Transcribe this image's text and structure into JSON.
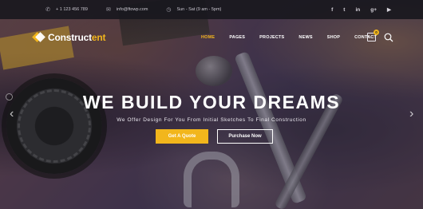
{
  "topbar": {
    "phone": "+ 1 123 456 789",
    "email": "info@ftowp.com",
    "hours": "Sun - Sat (9 am - 5pm)",
    "icons": {
      "phone": "phone-icon",
      "email": "envelope-icon",
      "hours": "clock-icon"
    },
    "socials": [
      {
        "name": "facebook-icon",
        "glyph": "f"
      },
      {
        "name": "twitter-icon",
        "glyph": "t"
      },
      {
        "name": "linkedin-icon",
        "glyph": "in"
      },
      {
        "name": "google-plus-icon",
        "glyph": "g+"
      },
      {
        "name": "youtube-icon",
        "glyph": "▶"
      }
    ]
  },
  "brand": {
    "name_main": "Construct",
    "name_accent": "ent",
    "accent_color": "#f2b61c"
  },
  "nav": {
    "items": [
      {
        "label": "HOME",
        "active": true
      },
      {
        "label": "PAGES",
        "active": false
      },
      {
        "label": "PROJECTS",
        "active": false
      },
      {
        "label": "NEWS",
        "active": false
      },
      {
        "label": "SHOP",
        "active": false
      },
      {
        "label": "CONTACT",
        "active": false
      }
    ],
    "cart_count": "0"
  },
  "hero": {
    "headline": "WE BUILD YOUR DREAMS",
    "subline": "We Offer Design For You From Initial Sketches To Final Construction",
    "primary_cta": "Get A Quote",
    "secondary_cta": "Purchase Now"
  }
}
